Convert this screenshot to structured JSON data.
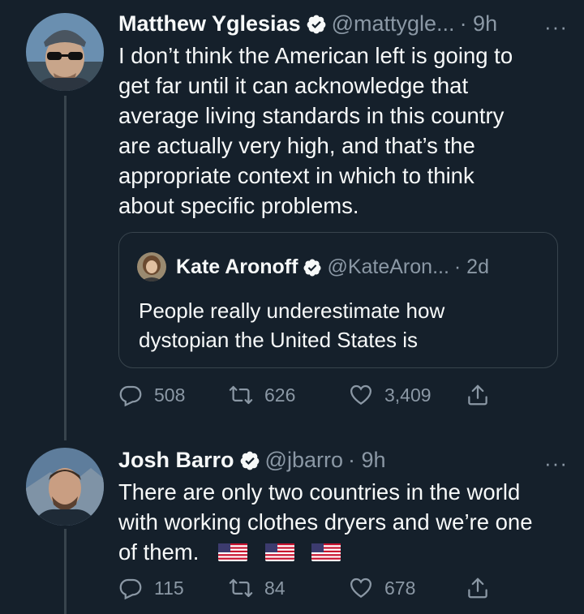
{
  "tweets": [
    {
      "author_name": "Matthew Yglesias",
      "handle": "@mattygle...",
      "time": "· 9h",
      "more": "···",
      "text_lines": [
        "I don’t think the American left is going to",
        "get far until it can acknowledge that",
        "average living standards in this country",
        "are actually very high, and that’s the",
        "appropriate context in which to think",
        "about specific problems."
      ],
      "quote": {
        "author_name": "Kate Aronoff",
        "handle": "@KateAron...",
        "time": "· 2d",
        "text_lines": [
          "People really underestimate how",
          "dystopian the United States is"
        ]
      },
      "stats": {
        "replies": "508",
        "retweets": "626",
        "likes": "3,409"
      }
    },
    {
      "author_name": "Josh Barro",
      "handle": "@jbarro",
      "time": "· 9h",
      "more": "···",
      "text_lines": [
        "There are only two countries in the world",
        "with working clothes dryers and we’re one",
        "of them."
      ],
      "emoji": [
        "us-flag",
        "us-flag",
        "us-flag"
      ],
      "stats": {
        "replies": "115",
        "retweets": "84",
        "likes": "678"
      }
    }
  ],
  "colors": {
    "background": "#15202b",
    "text_primary": "#f7f9f9",
    "text_secondary": "#8b98a5",
    "verified": "#f7f9f9",
    "border": "#38444d"
  }
}
